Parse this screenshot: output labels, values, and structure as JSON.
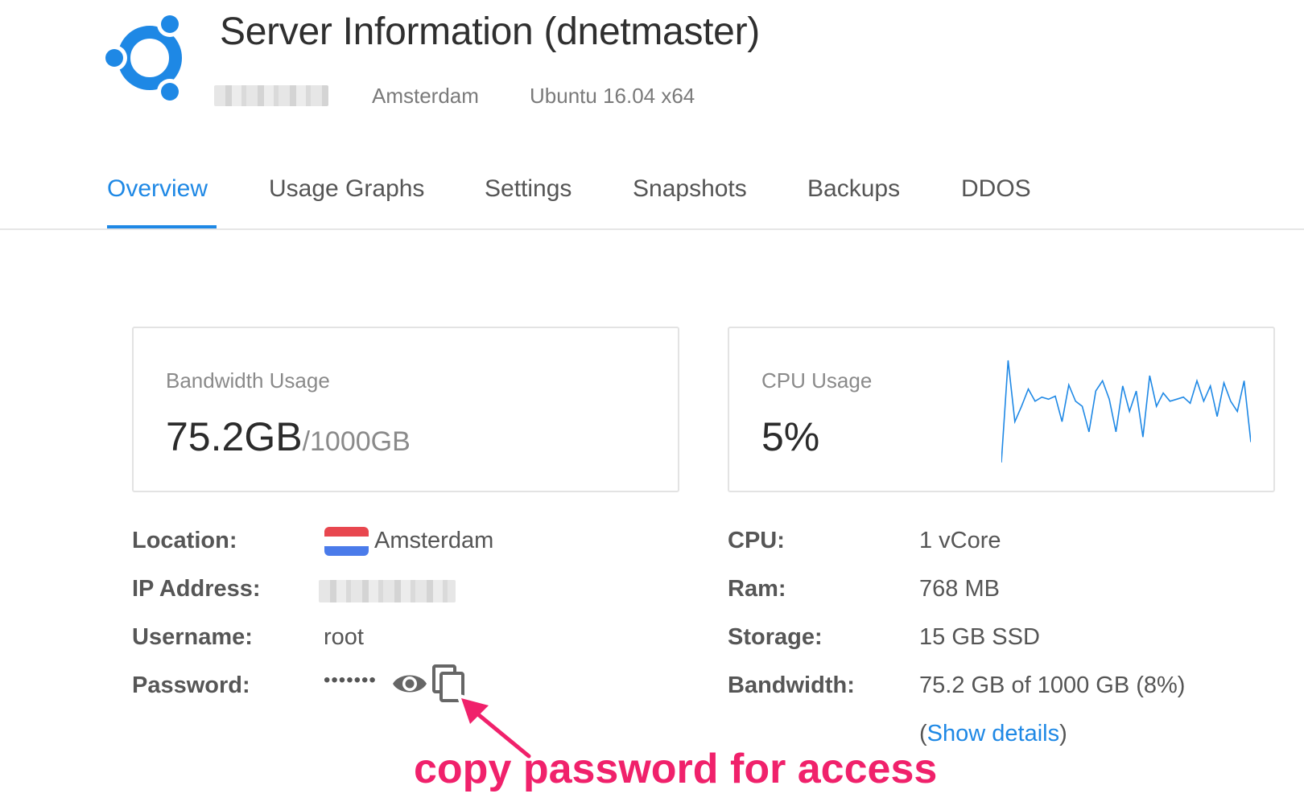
{
  "header": {
    "title": "Server Information (dnetmaster)",
    "location": "Amsterdam",
    "os": "Ubuntu 16.04 x64"
  },
  "tabs": [
    {
      "label": "Overview",
      "active": true
    },
    {
      "label": "Usage Graphs"
    },
    {
      "label": "Settings"
    },
    {
      "label": "Snapshots"
    },
    {
      "label": "Backups"
    },
    {
      "label": "DDOS"
    }
  ],
  "bandwidth_card": {
    "label": "Bandwidth Usage",
    "used": "75.2GB",
    "total": "/1000GB"
  },
  "cpu_card": {
    "label": "CPU Usage",
    "value": "5%",
    "sparkline": [
      0,
      100,
      40,
      55,
      72,
      60,
      64,
      62,
      65,
      40,
      76,
      60,
      55,
      30,
      70,
      80,
      62,
      30,
      75,
      50,
      70,
      25,
      85,
      55,
      68,
      60,
      62,
      64,
      58,
      80,
      60,
      75,
      45,
      78,
      60,
      50,
      80,
      20
    ]
  },
  "info_left": {
    "location_label": "Location:",
    "location_value": "Amsterdam",
    "ip_label": "IP Address:",
    "username_label": "Username:",
    "username_value": "root",
    "password_label": "Password:",
    "password_mask": "•••••••"
  },
  "info_right": {
    "cpu_label": "CPU:",
    "cpu_value": "1 vCore",
    "ram_label": "Ram:",
    "ram_value": "768 MB",
    "storage_label": "Storage:",
    "storage_value": "15 GB SSD",
    "bandwidth_label": "Bandwidth:",
    "bandwidth_value": "75.2 GB of 1000 GB (8%)",
    "show_details": "Show details"
  },
  "annotation": {
    "text": "copy password for access"
  },
  "colors": {
    "accent": "#1e88e5",
    "annotation": "#f0216b",
    "flag_red": "#e8474f",
    "flag_blue": "#4a7bea"
  }
}
